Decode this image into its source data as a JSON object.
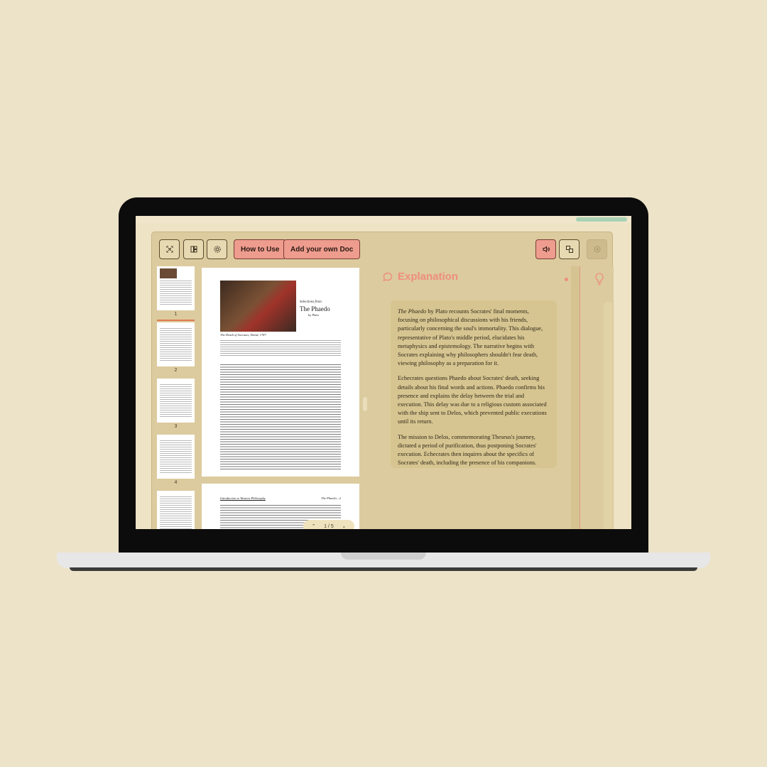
{
  "toolbar": {
    "how_to_use_label": "How to Use",
    "add_doc_label": "Add your own Doc"
  },
  "thumbnails": [
    {
      "page": "1"
    },
    {
      "page": "2"
    },
    {
      "page": "3"
    },
    {
      "page": "4"
    }
  ],
  "document": {
    "heading_pre": "Selections from",
    "heading_title": "The Phaedo",
    "heading_author": "by Plato",
    "caption": "The Death of Socrates, David, 1787.",
    "page2_left": "Introduction to Western Philosophy",
    "page2_right": "The Phaedo—2",
    "pager_label": "1 / 5"
  },
  "explanation": {
    "title": "Explanation",
    "p1_lead": "The Phaedo",
    "p1_rest": " by Plato recounts Socrates' final moments, focusing on philosophical discussions with his friends, particularly concerning the soul's immortality. This dialogue, representative of Plato's middle period, elucidates his metaphysics and epistemology. The narrative begins with Socrates explaining why philosophers shouldn't fear death, viewing philosophy as a preparation for it.",
    "p2": "Echecrates questions Phaedo about Socrates' death, seeking details about his final words and actions. Phaedo confirms his presence and explains the delay between the trial and execution. This delay was due to a religious custom associated with the ship sent to Delos, which prevented public executions until its return.",
    "p3": "The mission to Delos, commemorating Theseus's journey, dictated a period of purification, thus postponing Socrates' execution. Echecrates then inquires about the specifics of Socrates' death, including the presence of his companions."
  },
  "colors": {
    "background": "#EDE3C9",
    "accent": "#EE9C8E",
    "panel": "#DCCB9E"
  }
}
